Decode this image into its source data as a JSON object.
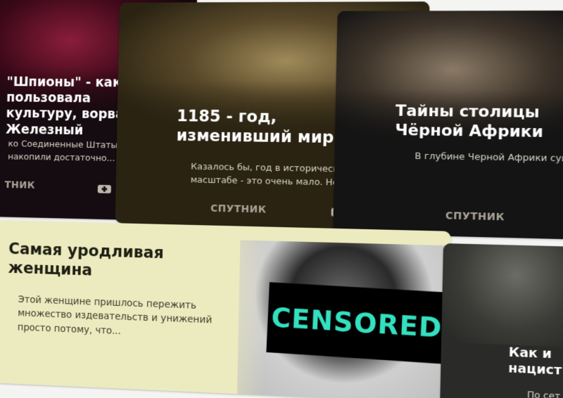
{
  "feed": {
    "cards": [
      {
        "title": "\"Шпионы\" - как пользовала культуру, ворвать Железный",
        "description": "ко Соединенные Штаты и й Союз накопили достаточно...",
        "source": "ТНИК"
      },
      {
        "title": "1185 - год, изменивший мир",
        "description": "Казалось бы, год в историческом масштабе - это очень мало. Но...",
        "source": "СПУТНИК"
      },
      {
        "title": "Тайны столицы Чёрной Африки",
        "description": "В глубине Черной Африки сущ город, который переворачи представление об историче",
        "source": "СПУТНИК"
      },
      {
        "title": "Самая уродливая женщина",
        "description": "Этой женщине пришлось пережить множество издевательств и унижений просто потому, что...",
        "overlay_label": "CENSORED"
      },
      {
        "title": "Как и нацист",
        "description": "По сет"
      }
    ]
  },
  "icons": {
    "add": "plus-folder-icon",
    "like": "thumbs-up-icon",
    "dislike": "thumbs-down-icon"
  },
  "colors": {
    "censor_text": "#33e0c0"
  }
}
